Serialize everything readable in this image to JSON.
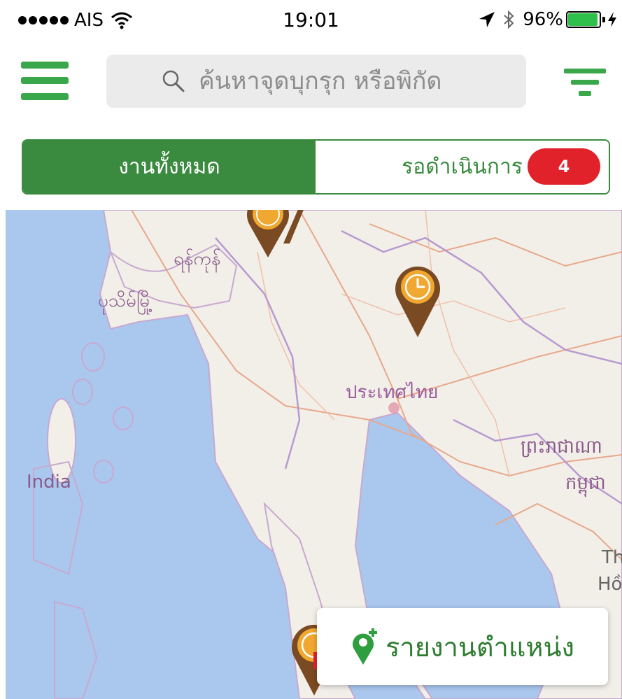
{
  "status_bar": {
    "carrier": "AIS",
    "time": "19:01",
    "battery": "96%",
    "battery_level": 0.96,
    "icons": [
      "signal-dots-icon",
      "wifi-icon",
      "location-arrow-icon",
      "bluetooth-icon",
      "battery-icon",
      "charging-icon"
    ]
  },
  "header": {
    "menu_icon": "hamburger-icon",
    "search_placeholder": "ค้นหาจุดบุกรุก หรือพิกัด",
    "search_value": "",
    "filter_icon": "filter-icon"
  },
  "tabs": [
    {
      "label": "งานทั้งหมด",
      "selected": true
    },
    {
      "label": "รอดำเนินการ",
      "badge": "4",
      "selected": false
    }
  ],
  "map": {
    "labels": {
      "yangon": "ရန်ကုန်",
      "pathein": "ပုသိမ်မြို့",
      "thailand": "ประเทศไทย",
      "india": "India",
      "cambodia_1": "ព្រះរាជាណា",
      "cambodia_2": "កម្ពុជា",
      "vietnam_1": "Th",
      "vietnam_2": "Hồ"
    },
    "pins": [
      "pending-pin-icon",
      "pending-pin-icon",
      "pending-pin-icon",
      "pending-pin-icon"
    ],
    "colors": {
      "water": "#aac8ee",
      "land": "#f2efe9",
      "pin": "#7a4a22",
      "pin_accent": "#f0a830"
    }
  },
  "report_button": {
    "label": "รายงานตำแหน่ง",
    "icon": "add-location-icon"
  },
  "colors": {
    "primary": "#3a8a3f",
    "accent_green": "#3aa84a",
    "badge": "#e2222a"
  }
}
